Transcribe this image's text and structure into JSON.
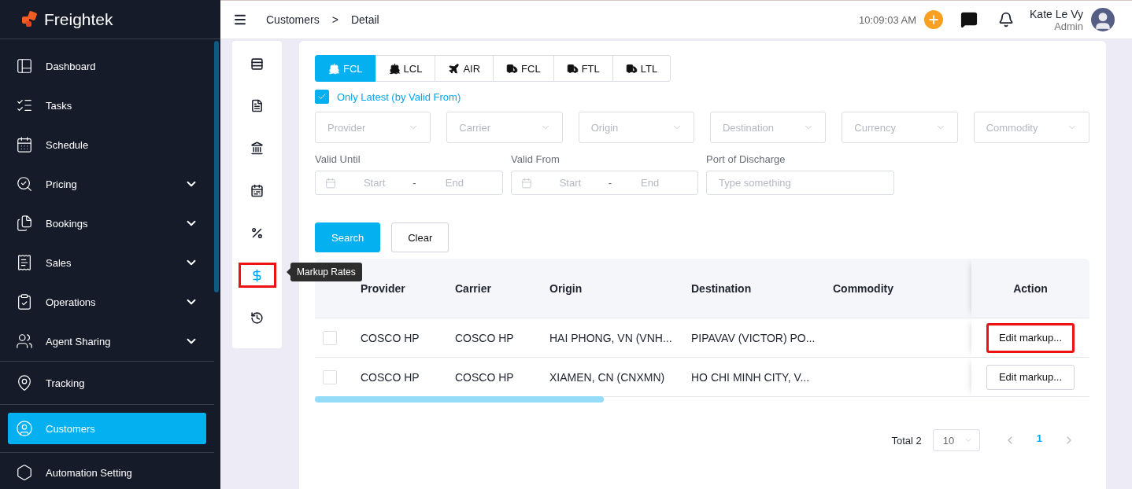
{
  "brand": {
    "name": "Freightek"
  },
  "sidebar": {
    "sections": [
      {
        "items": [
          {
            "label": "Dashboard",
            "expandable": false,
            "selected": false
          },
          {
            "label": "Tasks",
            "expandable": false,
            "selected": false
          },
          {
            "label": "Schedule",
            "expandable": false,
            "selected": false
          },
          {
            "label": "Pricing",
            "expandable": true,
            "selected": false
          },
          {
            "label": "Bookings",
            "expandable": true,
            "selected": false
          },
          {
            "label": "Sales",
            "expandable": true,
            "selected": false
          },
          {
            "label": "Operations",
            "expandable": true,
            "selected": false
          },
          {
            "label": "Agent Sharing",
            "expandable": true,
            "selected": false
          }
        ]
      },
      {
        "items": [
          {
            "label": "Tracking",
            "expandable": false,
            "selected": false
          }
        ]
      },
      {
        "items": [
          {
            "label": "Customers",
            "expandable": false,
            "selected": true
          }
        ]
      },
      {
        "items": [
          {
            "label": "Automation Setting",
            "expandable": false,
            "selected": false
          }
        ]
      }
    ]
  },
  "header": {
    "breadcrumb": [
      "Customers",
      "Detail"
    ],
    "separator": ">",
    "time": "10:09:03 AM",
    "user": {
      "name": "Kate Le Vy",
      "role": "Admin"
    }
  },
  "rail": {
    "tooltip": "Markup Rates",
    "items": [
      {
        "selected": false,
        "highlighted": false
      },
      {
        "selected": false,
        "highlighted": false
      },
      {
        "selected": false,
        "highlighted": false
      },
      {
        "selected": false,
        "highlighted": false
      },
      {
        "selected": false,
        "highlighted": false
      },
      {
        "selected": true,
        "highlighted": true
      },
      {
        "selected": false,
        "highlighted": false
      }
    ]
  },
  "mode_tabs": [
    {
      "label": "FCL",
      "selected": true
    },
    {
      "label": "LCL",
      "selected": false
    },
    {
      "label": "AIR",
      "selected": false
    },
    {
      "label": "FCL",
      "selected": false
    },
    {
      "label": "FTL",
      "selected": false
    },
    {
      "label": "LTL",
      "selected": false
    }
  ],
  "only_latest": {
    "label": "Only Latest (by Valid From)",
    "checked": true
  },
  "selects": [
    {
      "placeholder": "Provider"
    },
    {
      "placeholder": "Carrier"
    },
    {
      "placeholder": "Origin"
    },
    {
      "placeholder": "Destination"
    },
    {
      "placeholder": "Currency"
    },
    {
      "placeholder": "Commodity"
    }
  ],
  "date_ranges": [
    {
      "label": "Valid Until",
      "start": "Start",
      "separator": "-",
      "end": "End"
    },
    {
      "label": "Valid From",
      "start": "Start",
      "separator": "-",
      "end": "End"
    }
  ],
  "port_field": {
    "label": "Port of Discharge",
    "placeholder": "Type something"
  },
  "buttons": [
    {
      "label": "Search",
      "kind": "primary"
    },
    {
      "label": "Clear",
      "kind": "default"
    }
  ],
  "table": {
    "columns": [
      "Provider",
      "Carrier",
      "Origin",
      "Destination",
      "Commodity"
    ],
    "action_column": "Action",
    "rows": [
      {
        "checked": false,
        "cells": [
          "COSCO HP",
          "COSCO HP",
          "HAI PHONG, VN (VNH...",
          "PIPAVAV (VICTOR) PO..."
        ],
        "action": "Edit markup...",
        "highlighted": true
      },
      {
        "checked": false,
        "cells": [
          "COSCO HP",
          "COSCO HP",
          "XIAMEN, CN (CNXMN)",
          "HO CHI MINH CITY, V..."
        ],
        "action": "Edit markup...",
        "highlighted": false
      }
    ]
  },
  "pagination": {
    "total": "Total 2",
    "page_size": "10",
    "pages": [
      {
        "label": "1",
        "selected": true
      }
    ]
  }
}
